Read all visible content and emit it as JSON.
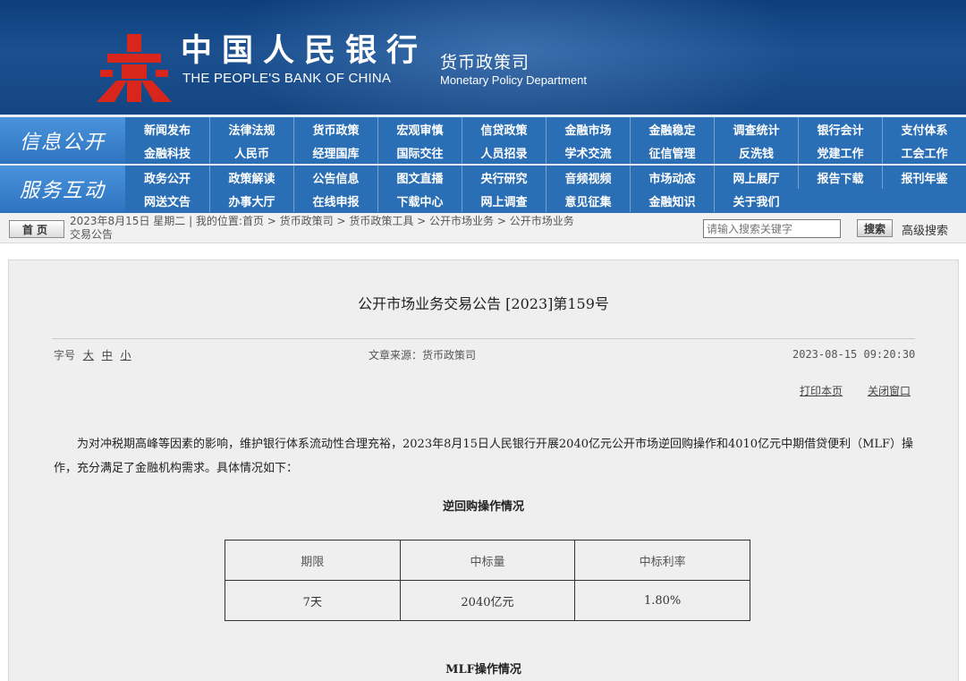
{
  "header": {
    "org_cn": "中国人民银行",
    "org_en": "THE PEOPLE'S BANK OF CHINA",
    "dept_cn": "货币政策司",
    "dept_en": "Monetary Policy Department",
    "colors": {
      "banner": "#1b4f8e",
      "nav": "#2a6fb6",
      "emblem": "#d9261c"
    }
  },
  "nav": {
    "group1_title": "信息公开",
    "group1_row1": [
      "新闻发布",
      "法律法规",
      "货币政策",
      "宏观审慎",
      "信贷政策",
      "金融市场",
      "金融稳定",
      "调查统计",
      "银行会计",
      "支付体系"
    ],
    "group1_row2": [
      "金融科技",
      "人民币",
      "经理国库",
      "国际交往",
      "人员招录",
      "学术交流",
      "征信管理",
      "反洗钱",
      "党建工作",
      "工会工作"
    ],
    "group2_title": "服务互动",
    "group2_row1": [
      "政务公开",
      "政策解读",
      "公告信息",
      "图文直播",
      "央行研究",
      "音频视频",
      "市场动态",
      "网上展厅",
      "报告下载",
      "报刊年鉴"
    ],
    "group2_row2": [
      "网送文告",
      "办事大厅",
      "在线申报",
      "下载中心",
      "网上调查",
      "意见征集",
      "金融知识",
      "关于我们"
    ]
  },
  "breadcrumb": {
    "home": "首页",
    "line1": "2023年8月15日 星期二 | 我的位置:首页 > 货币政策司 > 货币政策工具 > 公开市场业务 > 公开市场业务",
    "line2": "交易公告",
    "search_placeholder": "请输入搜索关键字",
    "search_button": "搜索",
    "advanced": "高级搜索"
  },
  "article": {
    "title": "公开市场业务交易公告 [2023]第159号",
    "font_size_label": "字号",
    "font_size_options": [
      "大",
      "中",
      "小"
    ],
    "source": "文章来源：货币政策司",
    "date": "2023-08-15 09:20:30",
    "print": "打印本页",
    "close": "关闭窗口",
    "paragraph": "为对冲税期高峰等因素的影响，维护银行体系流动性合理充裕，2023年8月15日人民银行开展2040亿元公开市场逆回购操作和4010亿元中期借贷便利（MLF）操作，充分满足了金融机构需求。具体情况如下：",
    "reverse_repo_title": "逆回购操作情况",
    "table_headers": [
      "期限",
      "中标量",
      "中标利率"
    ],
    "table_rows": [
      [
        "7天",
        "2040亿元",
        "1.80%"
      ]
    ],
    "mlf_title": "MLF操作情况"
  }
}
